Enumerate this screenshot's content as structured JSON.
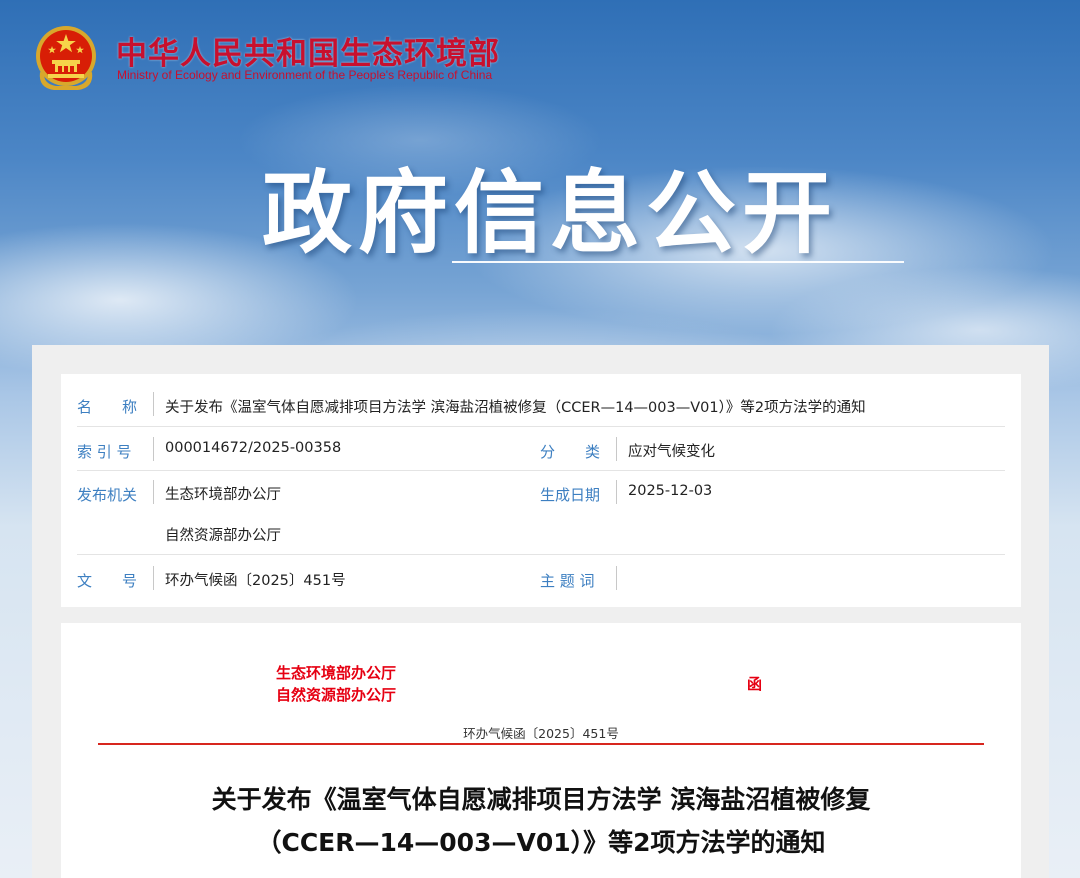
{
  "header": {
    "site_title": "中华人民共和国生态环境部",
    "site_subtitle": "Ministry of Ecology and Environment of the People's Republic of China",
    "emblem_icon": "national-emblem-icon"
  },
  "hero": {
    "title": "政府信息公开"
  },
  "info": {
    "name_label": "名　　称",
    "name_value": "关于发布《温室气体自愿减排项目方法学 滨海盐沼植被修复（CCER—14—003—V01）》等2项方法学的通知",
    "index_label": "索 引 号",
    "index_value": "000014672/2025-00358",
    "category_label": "分　　类",
    "category_value": "应对气候变化",
    "issuer_label": "发布机关",
    "issuer_values": [
      "生态环境部办公厅",
      "自然资源部办公厅"
    ],
    "date_label": "生成日期",
    "date_value": "2025-12-03",
    "docno_label": "文　　号",
    "docno_value": "环办气候函〔2025〕451号",
    "subject_label": "主 题 词",
    "subject_value": ""
  },
  "document": {
    "issuers": [
      "生态环境部办公厅",
      "自然资源部办公厅"
    ],
    "doc_type": "函",
    "doc_number": "环办气候函〔2025〕451号",
    "title_lines": [
      "关于发布《温室气体自愿减排项目方法学 滨海盐沼植被修复",
      "（CCER—14—003—V01）》等2项方法学的通知"
    ]
  },
  "colors": {
    "brand_red": "#c8102e",
    "label_blue": "#3d7fc1",
    "doc_red": "#e60012"
  }
}
